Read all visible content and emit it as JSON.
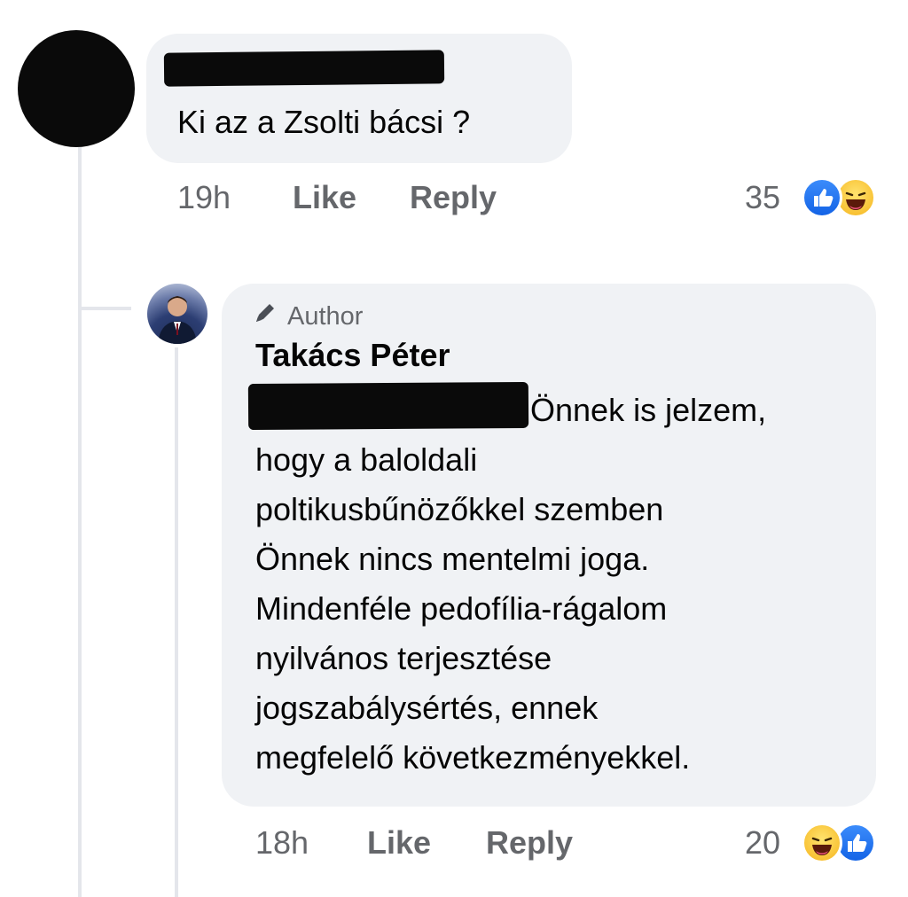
{
  "comment1": {
    "text": "Ki az a Zsolti bácsi ?",
    "time": "19h",
    "like_label": "Like",
    "reply_label": "Reply",
    "reaction_count": "35",
    "reactions": [
      "like-icon",
      "haha-icon"
    ]
  },
  "comment2": {
    "badge": "Author",
    "author": "Takács Péter",
    "lines": [
      "Önnek is jelzem,",
      "hogy a baloldali",
      "poltikusbűnözőkkel szemben",
      "Önnek nincs mentelmi joga.",
      "Mindenféle pedofília-rágalom",
      "nyilvános terjesztése",
      "jogszabálysértés, ennek",
      "megfelelő következményekkel."
    ],
    "time": "18h",
    "like_label": "Like",
    "reply_label": "Reply",
    "reaction_count": "20",
    "reactions": [
      "haha-icon",
      "like-icon"
    ]
  },
  "colors": {
    "bubble": "#f0f2f5",
    "meta_text": "#65676b",
    "like_blue": "#1877f2",
    "redaction": "#0a0a0a"
  }
}
